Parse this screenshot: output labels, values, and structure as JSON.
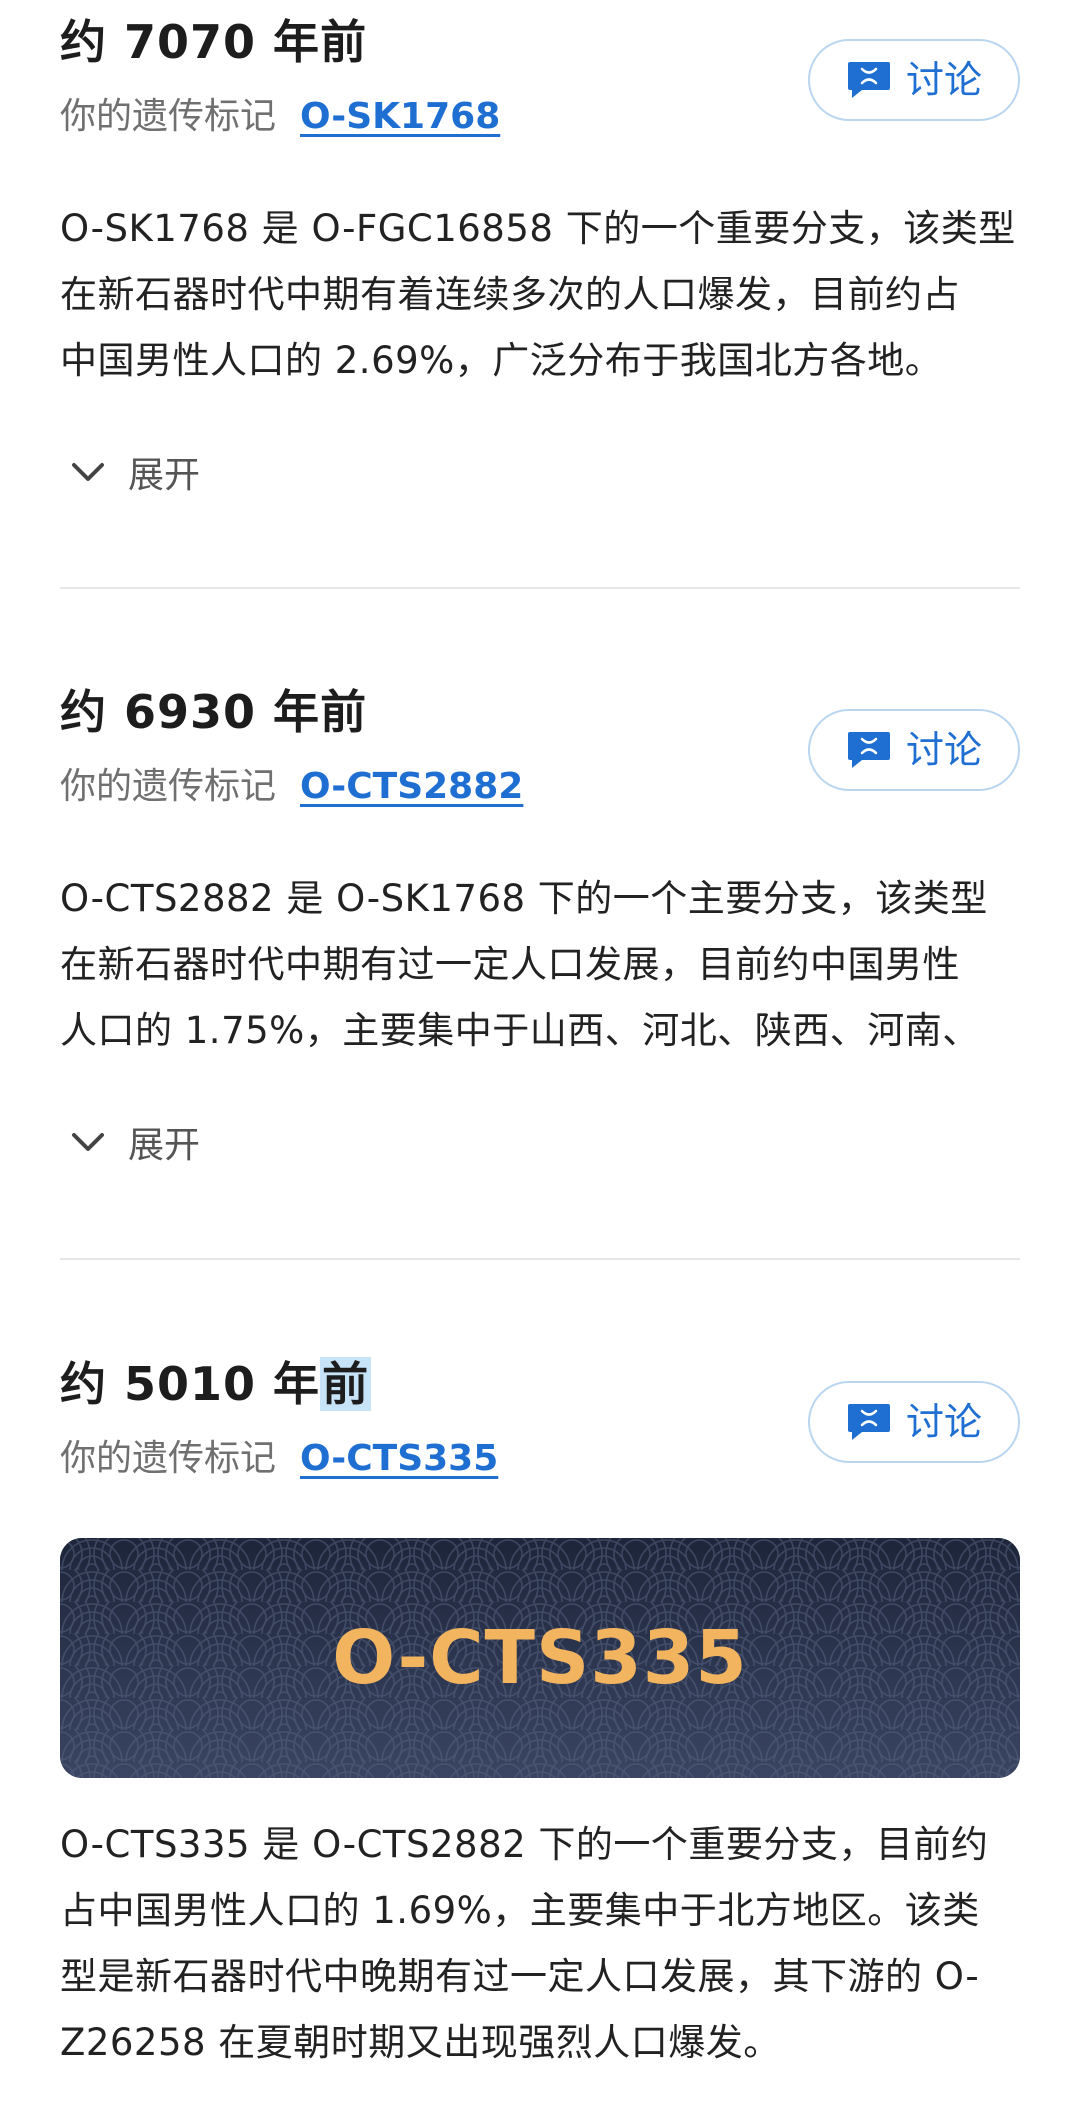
{
  "entries": [
    {
      "title_prefix": "约 7070 年",
      "title_suffix": "前",
      "marker_label": "你的遗传标记",
      "marker": "O-SK1768",
      "discuss": "讨论",
      "desc_lines": [
        "O-SK1768 是 O-FGC16858 下的一个重要分支，该类型",
        "在新石器时代中期有着连续多次的人口爆发，目前约占",
        "中国男性人口的 2.69%，广泛分布于我国北方各地。"
      ],
      "expand": "展开"
    },
    {
      "title_prefix": "约 6930 年",
      "title_suffix": "前",
      "marker_label": "你的遗传标记",
      "marker": "O-CTS2882",
      "discuss": "讨论",
      "desc_lines": [
        "O-CTS2882 是 O-SK1768 下的一个主要分支，该类型",
        "在新石器时代中期有过一定人口发展，目前约中国男性",
        "人口的 1.75%，主要集中于山西、河北、陕西、河南、"
      ],
      "expand": "展开"
    },
    {
      "title_prefix": "约 5010 年",
      "title_suffix": "前",
      "marker_label": "你的遗传标记",
      "marker": "O-CTS335",
      "discuss": "讨论",
      "banner": "O-CTS335",
      "desc_lines": [
        "O-CTS335 是 O-CTS2882 下的一个重要分支，目前约",
        "占中国男性人口的 1.69%，主要集中于北方地区。该类",
        "型是新石器时代中晚期有过一定人口发展，其下游的 O-",
        "Z26258 在夏朝时期又出现强烈人口爆发。"
      ]
    }
  ],
  "icons": {
    "discuss": "chat-bubble-icon",
    "expand": "chevron-down-icon"
  },
  "colors": {
    "link": "#1e6fd1",
    "banner_bg": "#262f47",
    "banner_text": "#f2b45e",
    "selection": "#c7e3f7"
  }
}
